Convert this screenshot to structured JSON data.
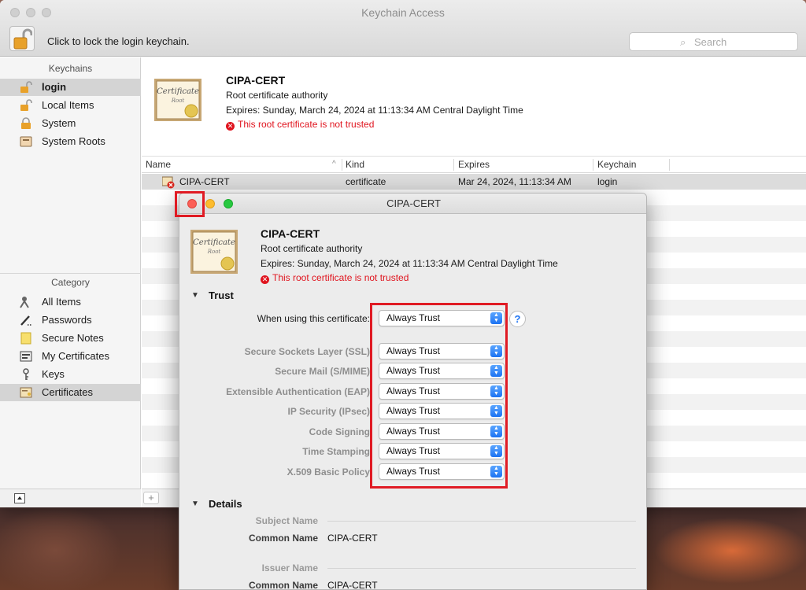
{
  "window": {
    "title": "Keychain Access",
    "lock_label": "Click to lock the login keychain.",
    "search_placeholder": "Search"
  },
  "sidebar": {
    "keychains_header": "Keychains",
    "keychains": [
      {
        "label": "login",
        "icon": "unlocked-padlock-icon",
        "selected": true
      },
      {
        "label": "Local Items",
        "icon": "unlocked-padlock-icon"
      },
      {
        "label": "System",
        "icon": "locked-padlock-icon"
      },
      {
        "label": "System Roots",
        "icon": "cabinet-icon"
      }
    ],
    "category_header": "Category",
    "categories": [
      {
        "label": "All Items",
        "icon": "people-icon"
      },
      {
        "label": "Passwords",
        "icon": "pencil-icon"
      },
      {
        "label": "Secure Notes",
        "icon": "note-icon"
      },
      {
        "label": "My Certificates",
        "icon": "id-card-icon"
      },
      {
        "label": "Keys",
        "icon": "key-icon"
      },
      {
        "label": "Certificates",
        "icon": "certificate-icon",
        "selected": true
      }
    ]
  },
  "header_cert": {
    "name": "CIPA-CERT",
    "type": "Root certificate authority",
    "expires": "Expires: Sunday, March 24, 2024 at 11:13:34 AM Central Daylight Time",
    "error": "This root certificate is not trusted"
  },
  "table": {
    "columns": [
      "Name",
      "Kind",
      "Expires",
      "Keychain"
    ],
    "rows": [
      {
        "name": "CIPA-CERT",
        "kind": "certificate",
        "expires": "Mar 24, 2024, 11:13:34 AM",
        "keychain": "login"
      }
    ]
  },
  "dialog": {
    "title": "CIPA-CERT",
    "cert_name": "CIPA-CERT",
    "cert_type": "Root certificate authority",
    "cert_expires": "Expires: Sunday, March 24, 2024 at 11:13:34 AM Central Daylight Time",
    "cert_error": "This root certificate is not trusted",
    "trust_section": "Trust",
    "when_using_label": "When using this certificate:",
    "when_using_value": "Always Trust",
    "help": "?",
    "policies": [
      {
        "label": "Secure Sockets Layer (SSL)",
        "value": "Always Trust"
      },
      {
        "label": "Secure Mail (S/MIME)",
        "value": "Always Trust"
      },
      {
        "label": "Extensible Authentication (EAP)",
        "value": "Always Trust"
      },
      {
        "label": "IP Security (IPsec)",
        "value": "Always Trust"
      },
      {
        "label": "Code Signing",
        "value": "Always Trust"
      },
      {
        "label": "Time Stamping",
        "value": "Always Trust"
      },
      {
        "label": "X.509 Basic Policy",
        "value": "Always Trust"
      }
    ],
    "details_section": "Details",
    "subject_name_header": "Subject Name",
    "subject_common_name_label": "Common Name",
    "subject_common_name_value": "CIPA-CERT",
    "issuer_name_header": "Issuer Name",
    "issuer_common_name_label": "Common Name",
    "issuer_common_name_value": "CIPA-CERT"
  },
  "colors": {
    "error_red": "#e0141e",
    "highlight_red": "#e01b24",
    "popup_blue": "#1d73f2"
  }
}
